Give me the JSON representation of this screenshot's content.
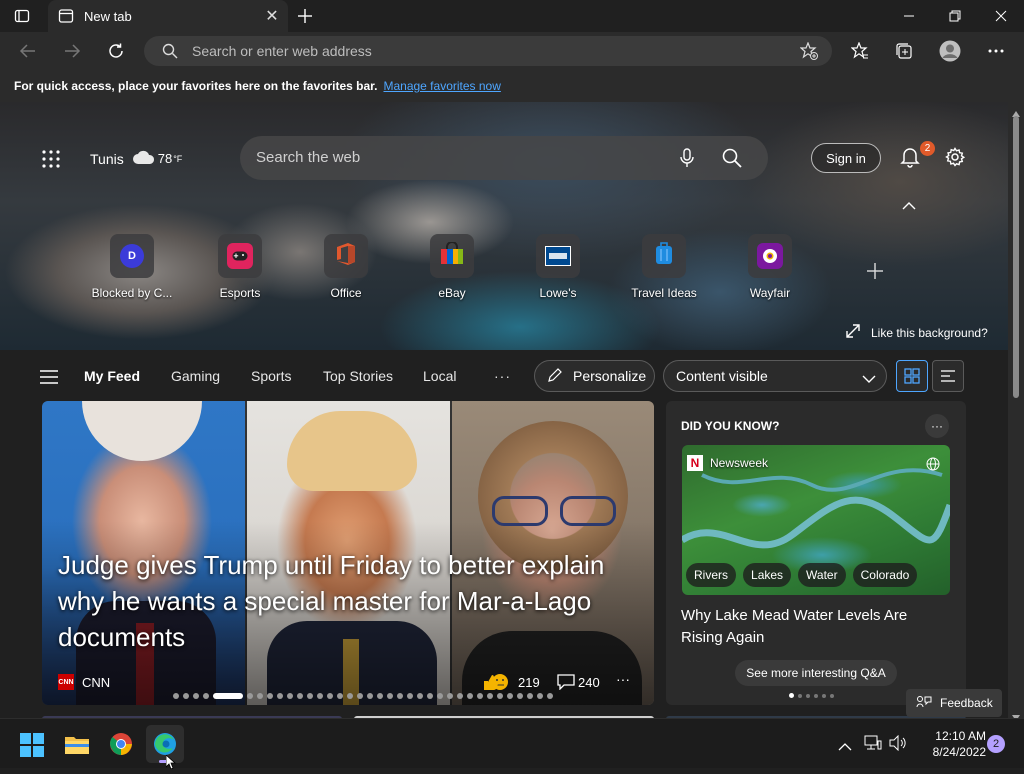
{
  "browser": {
    "tab_title": "New tab",
    "address_placeholder": "Search or enter web address",
    "favorites_bar_text": "For quick access, place your favorites here on the favorites bar.",
    "favorites_bar_link": "Manage favorites now"
  },
  "hero": {
    "location": "Tunis",
    "temperature": "78",
    "temp_unit": "°F",
    "search_placeholder": "Search the web",
    "sign_in_label": "Sign in",
    "notification_count": "2",
    "like_background_label": "Like this background?",
    "quick_links": [
      {
        "label": "Blocked by C...",
        "icon": "letter-d-icon",
        "letter": "D",
        "color": "#3b3bd9"
      },
      {
        "label": "Esports",
        "icon": "gamepad-icon",
        "color": "#e0245e"
      },
      {
        "label": "Office",
        "icon": "office-icon",
        "color": "#d83b01"
      },
      {
        "label": "eBay",
        "icon": "ebay-bag-icon",
        "color": "#e53238"
      },
      {
        "label": "Lowe's",
        "icon": "lowes-icon",
        "color": "#004990"
      },
      {
        "label": "Travel Ideas",
        "icon": "suitcase-icon",
        "color": "#1f8ce0"
      },
      {
        "label": "Wayfair",
        "icon": "wayfair-icon",
        "color": "#7b189f"
      }
    ]
  },
  "feed_nav": {
    "tabs": [
      "My Feed",
      "Gaming",
      "Sports",
      "Top Stories",
      "Local"
    ],
    "more": "···",
    "personalize_label": "Personalize",
    "content_visibility": "Content visible"
  },
  "main_story": {
    "headline": "Judge gives Trump until Friday to better explain why he wants a special master for Mar-a-Lago documents",
    "source": "CNN",
    "reactions": "219",
    "comments": "240"
  },
  "side_card": {
    "title": "DID YOU KNOW?",
    "source": "Newsweek",
    "tags": [
      "Rivers",
      "Lakes",
      "Water",
      "Colorado"
    ],
    "headline": "Why Lake Mead Water Levels Are Rising Again",
    "cta": "See more interesting Q&A",
    "feedback_label": "Feedback"
  },
  "taskbar": {
    "time": "12:10 AM",
    "date": "8/24/2022",
    "notification_count": "2"
  }
}
